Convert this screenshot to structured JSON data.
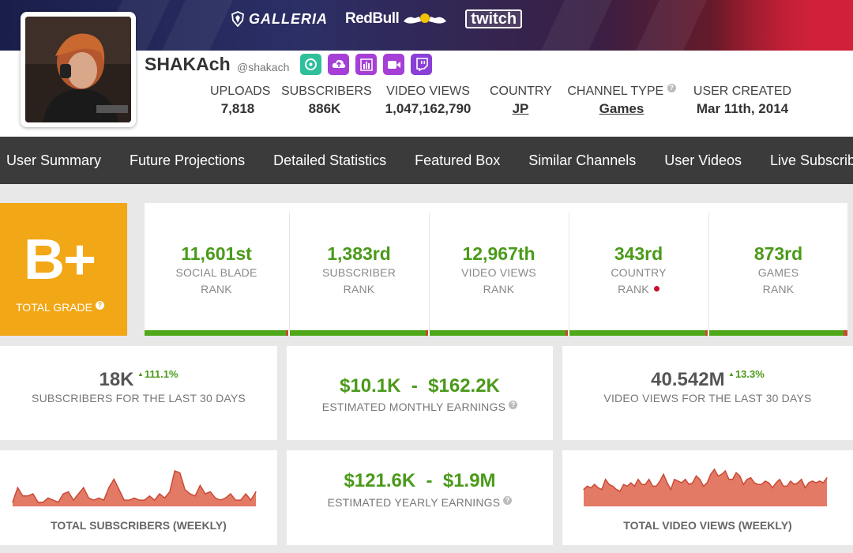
{
  "banner": {
    "sponsors": [
      "GALLERIA",
      "RedBull",
      "twitch"
    ]
  },
  "channel": {
    "name": "SHAKAch",
    "handle": "@shakach"
  },
  "social_icons": [
    {
      "name": "socialblade-icon",
      "color": "#2fbf9b"
    },
    {
      "name": "upload-cloud-icon",
      "color": "#a63fd6"
    },
    {
      "name": "bar-chart-icon",
      "color": "#a63fd6"
    },
    {
      "name": "video-camera-icon",
      "color": "#a63fd6"
    },
    {
      "name": "twitch-icon",
      "color": "#8a3fd6"
    }
  ],
  "stats": {
    "uploads": {
      "label": "UPLOADS",
      "value": "7,818"
    },
    "subscribers": {
      "label": "SUBSCRIBERS",
      "value": "886K"
    },
    "video_views": {
      "label": "VIDEO VIEWS",
      "value": "1,047,162,790"
    },
    "country": {
      "label": "COUNTRY",
      "value": "JP"
    },
    "channel_type": {
      "label": "CHANNEL TYPE",
      "value": "Games"
    },
    "user_created": {
      "label": "USER CREATED",
      "value": "Mar 11th, 2014"
    }
  },
  "nav": [
    "User Summary",
    "Future Projections",
    "Detailed Statistics",
    "Featured Box",
    "Similar Channels",
    "User Videos",
    "Live Subscriber"
  ],
  "grade": {
    "letter": "B+",
    "label": "TOTAL GRADE"
  },
  "ranks": [
    {
      "value": "11,601st",
      "line1": "SOCIAL BLADE",
      "line2": "RANK"
    },
    {
      "value": "1,383rd",
      "line1": "SUBSCRIBER",
      "line2": "RANK"
    },
    {
      "value": "12,967th",
      "line1": "VIDEO VIEWS",
      "line2": "RANK"
    },
    {
      "value": "343rd",
      "line1": "COUNTRY",
      "line2": "RANK"
    },
    {
      "value": "873rd",
      "line1": "GAMES",
      "line2": "RANK"
    }
  ],
  "subscribers_30d": {
    "value": "18K",
    "delta": "111.1%",
    "label": "SUBSCRIBERS FOR THE LAST 30 DAYS"
  },
  "monthly_earnings": {
    "value": "$10.1K  -  $162.2K",
    "label": "ESTIMATED MONTHLY EARNINGS"
  },
  "views_30d": {
    "value": "40.542M",
    "delta": "13.3%",
    "label": "VIDEO VIEWS FOR THE LAST 30 DAYS"
  },
  "yearly_earnings": {
    "value": "$121.6K  -  $1.9M",
    "label": "ESTIMATED YEARLY EARNINGS"
  },
  "colors": {
    "accent_green": "#4a9a1a",
    "grade_orange": "#f2a716",
    "sparkline": "#e06c55",
    "nav_bg": "#3b3b3b"
  },
  "chart_data": [
    {
      "type": "area",
      "title": "TOTAL SUBSCRIBERS (WEEKLY)",
      "values": [
        2,
        9,
        5,
        5,
        6,
        2,
        2,
        4,
        3,
        2,
        6,
        7,
        3,
        6,
        9,
        4,
        3,
        4,
        3,
        9,
        13,
        8,
        3,
        3,
        4,
        3,
        3,
        5,
        3,
        6,
        4,
        7,
        17,
        16,
        8,
        6,
        5,
        10,
        6,
        7,
        4,
        3,
        4,
        6,
        3,
        3,
        6,
        3,
        7
      ]
    },
    {
      "type": "area",
      "title": "TOTAL VIDEO VIEWS (WEEKLY)",
      "values": [
        10,
        12,
        11,
        13,
        11,
        10,
        16,
        13,
        12,
        10,
        9,
        13,
        12,
        14,
        12,
        16,
        13,
        13,
        16,
        12,
        12,
        15,
        19,
        14,
        10,
        16,
        15,
        14,
        16,
        13,
        14,
        18,
        16,
        12,
        14,
        19,
        22,
        18,
        19,
        21,
        16,
        16,
        20,
        18,
        13,
        16,
        17,
        14,
        13,
        13,
        15,
        14,
        11,
        14,
        16,
        12,
        12,
        15,
        13,
        14,
        16,
        11,
        14,
        15,
        14,
        15,
        14,
        17
      ]
    }
  ]
}
